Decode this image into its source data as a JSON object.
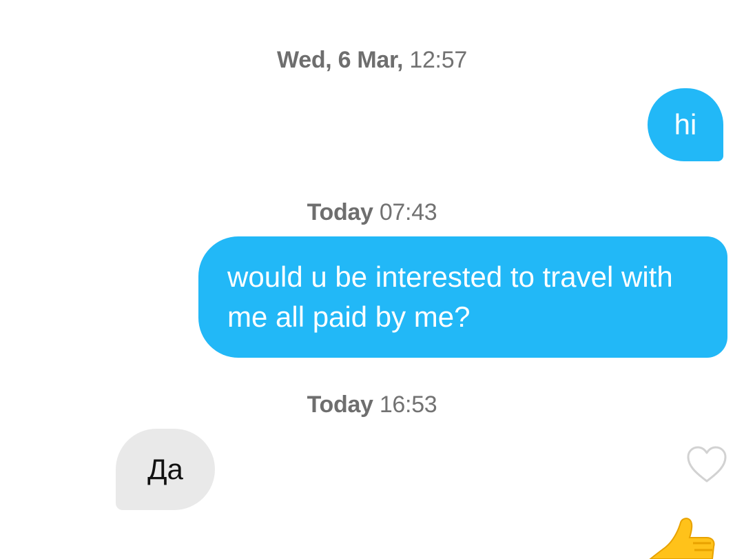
{
  "messages": [
    {
      "stamp": {
        "day": "Wed, 6 Mar",
        "sep": ", ",
        "time": "12:57"
      },
      "direction": "outgoing",
      "text": "hi"
    },
    {
      "stamp": {
        "day": "Today",
        "sep": " ",
        "time": "07:43"
      },
      "direction": "outgoing",
      "text": "would u be interested to travel with me all paid by me?"
    },
    {
      "stamp": {
        "day": "Today",
        "sep": " ",
        "time": "16:53"
      },
      "direction": "incoming",
      "text": "Да"
    }
  ],
  "icons": {
    "like": "heart-outline-icon",
    "reaction": "thumbs-up-emoji-icon"
  },
  "colors": {
    "outgoing_bubble": "#22b8f7",
    "incoming_bubble": "#e9e9e9",
    "timestamp": "#727272"
  }
}
